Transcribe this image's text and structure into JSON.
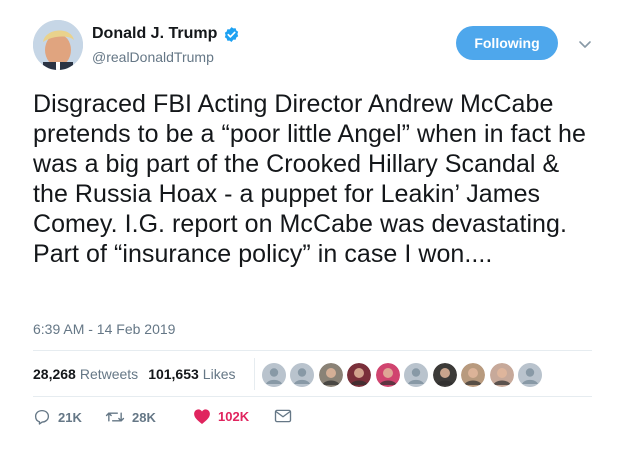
{
  "author": {
    "name": "Donald J. Trump",
    "handle": "@realDonaldTrump",
    "verified": true
  },
  "follow_button": {
    "label": "Following"
  },
  "tweet": {
    "text": "Disgraced FBI Acting Director Andrew McCabe pretends to be a “poor little Angel” when in fact he was a big part of the Crooked Hillary Scandal & the Russia Hoax - a puppet for Leakin’ James Comey. I.G. report on McCabe was devastating. Part of “insurance policy” in case I won....",
    "timestamp": "6:39 AM - 14 Feb 2019"
  },
  "stats": {
    "retweets_count": "28,268",
    "retweets_label": "Retweets",
    "likes_count": "101,653",
    "likes_label": "Likes"
  },
  "likers": [
    {
      "kind": "default",
      "color": "#b9c3cd"
    },
    {
      "kind": "default",
      "color": "#b9c3cd"
    },
    {
      "kind": "photo",
      "color": "#8a8276"
    },
    {
      "kind": "photo",
      "color": "#7a2f3a"
    },
    {
      "kind": "photo",
      "color": "#d0446f"
    },
    {
      "kind": "default",
      "color": "#b9c3cd"
    },
    {
      "kind": "photo",
      "color": "#3c3a38"
    },
    {
      "kind": "photo",
      "color": "#b89a7e"
    },
    {
      "kind": "photo",
      "color": "#c7a99a"
    },
    {
      "kind": "default",
      "color": "#b9c3cd"
    }
  ],
  "actions": {
    "replies": "21K",
    "retweets": "28K",
    "likes": "102K"
  },
  "colors": {
    "accent": "#4ea7ec",
    "verified": "#1da1f2",
    "like": "#e0245e",
    "secondary_text": "#657786"
  }
}
